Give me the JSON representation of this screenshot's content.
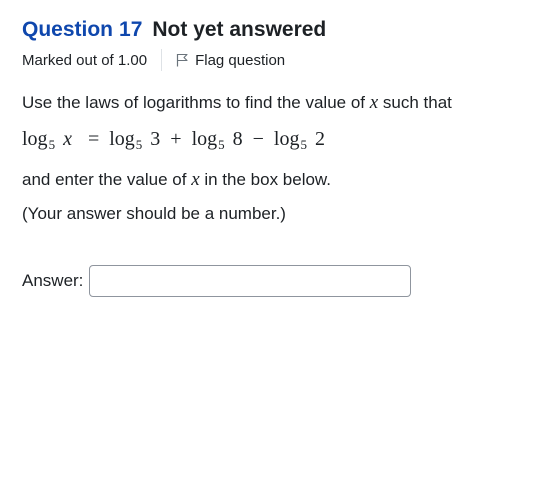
{
  "question": {
    "label": "Question",
    "number": "17",
    "state": "Not yet answered",
    "grade": "Marked out of 1.00",
    "flag_label": "Flag question"
  },
  "prompt": {
    "intro_text": "Use the laws of logarithms to find the value of ",
    "intro_var": "x",
    "intro_tail": " such that",
    "equation": {
      "log": "log",
      "base": "5",
      "lhs_var": "x",
      "eq": "=",
      "term1": "3",
      "plus": "+",
      "term2": "8",
      "minus": "−",
      "term3": "2"
    },
    "enter_text": "and enter the value of ",
    "enter_var": "x",
    "enter_tail": " in the box below.",
    "note": "(Your answer should be a number.)"
  },
  "answer": {
    "label": "Answer:",
    "value": "",
    "placeholder": ""
  },
  "icons": {
    "flag": "flag-outline-icon"
  }
}
